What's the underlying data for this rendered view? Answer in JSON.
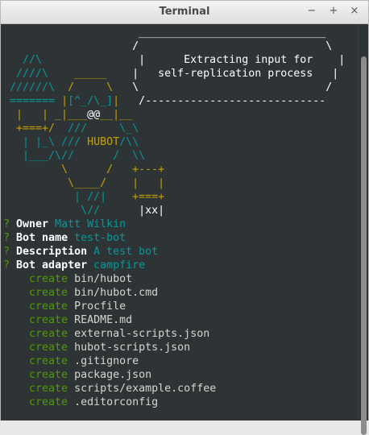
{
  "window": {
    "title": "Terminal",
    "minimize": "−",
    "maximize": "+",
    "close": "×"
  },
  "ascii": [
    [
      {
        "c": "wh",
        "t": "                     _____________________________  "
      }
    ],
    [
      {
        "c": "wh",
        "t": "                    /                             \\ "
      }
    ],
    [
      {
        "c": "cy",
        "t": "   //\\               "
      },
      {
        "c": "wh",
        "t": "|      Extracting input for    |"
      }
    ],
    [
      {
        "c": "cy",
        "t": "  ////\\    "
      },
      {
        "c": "ye",
        "t": "_____    "
      },
      {
        "c": "wh",
        "t": "|   self-replication process   |"
      }
    ],
    [
      {
        "c": "cy",
        "t": " //////\\  "
      },
      {
        "c": "ye",
        "t": "/     \\   "
      },
      {
        "c": "wh",
        "t": "\\                             /"
      }
    ],
    [
      {
        "c": "cy",
        "t": " ======= "
      },
      {
        "c": "ye",
        "t": "|"
      },
      {
        "c": "cy",
        "t": "[^_/\\_]"
      },
      {
        "c": "ye",
        "t": "|   "
      },
      {
        "c": "wh",
        "t": "/----------------------------"
      }
    ],
    [
      {
        "c": "ye",
        "t": "  |   | _|___"
      },
      {
        "c": "wh",
        "t": "@@"
      },
      {
        "c": "ye",
        "t": "__|__"
      }
    ],
    [
      {
        "c": "ye",
        "t": "  +===+/  "
      },
      {
        "c": "cy",
        "t": "///     \\_\\"
      }
    ],
    [
      {
        "c": "cy",
        "t": "   | |_\\ /// "
      },
      {
        "c": "ye",
        "t": "HUBOT"
      },
      {
        "c": "cy",
        "t": "/\\\\"
      }
    ],
    [
      {
        "c": "cy",
        "t": "   |___/\\//      /  \\\\"
      }
    ],
    [
      {
        "c": "ye",
        "t": "         \\      /   +---+"
      }
    ],
    [
      {
        "c": "ye",
        "t": "          \\____/    |   |"
      }
    ],
    [
      {
        "c": "cy",
        "t": "           | //|    "
      },
      {
        "c": "ye",
        "t": "+===+"
      }
    ],
    [
      {
        "c": "cy",
        "t": "            \\//      "
      },
      {
        "c": "wh",
        "t": "|xx|"
      }
    ]
  ],
  "prompts": [
    {
      "mark": "?",
      "label": "Owner",
      "value": "Matt Wilkin"
    },
    {
      "mark": "?",
      "label": "Bot name",
      "value": "test-bot"
    },
    {
      "mark": "?",
      "label": "Description",
      "value": "A test bot"
    },
    {
      "mark": "?",
      "label": "Bot adapter",
      "value": "campfire"
    }
  ],
  "created": [
    {
      "action": "create",
      "file": "bin/hubot"
    },
    {
      "action": "create",
      "file": "bin/hubot.cmd"
    },
    {
      "action": "create",
      "file": "Procfile"
    },
    {
      "action": "create",
      "file": "README.md"
    },
    {
      "action": "create",
      "file": "external-scripts.json"
    },
    {
      "action": "create",
      "file": "hubot-scripts.json"
    },
    {
      "action": "create",
      "file": ".gitignore"
    },
    {
      "action": "create",
      "file": "package.json"
    },
    {
      "action": "create",
      "file": "scripts/example.coffee"
    },
    {
      "action": "create",
      "file": ".editorconfig"
    }
  ]
}
